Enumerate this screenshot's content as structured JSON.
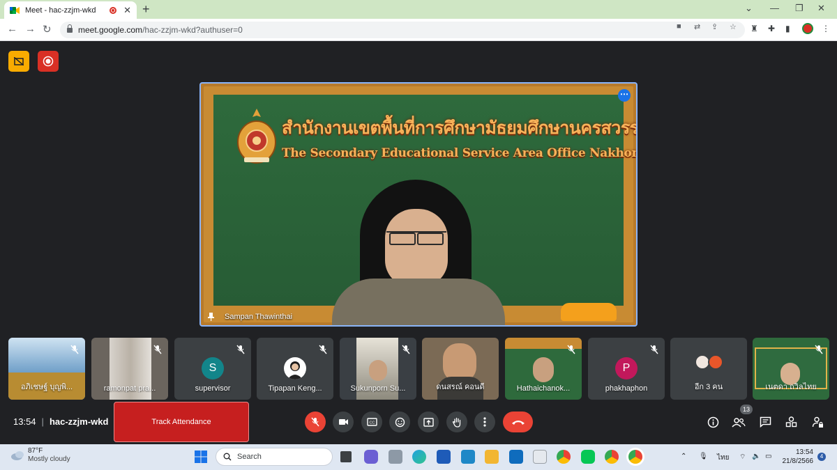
{
  "browser": {
    "tab_title": "Meet - hac-zzjm-wkd",
    "url_host": "meet.google.com",
    "url_path": "/hac-zzjm-wkd?authuser=0"
  },
  "stage": {
    "board_title_thai": "สำนักงานเขตพื้นที่การศึกษามัธยมศึกษานครสวรรค์",
    "board_title_eng": "The Secondary Educational Service Area Office Nakhon Sawan",
    "speaker_name": "Sampan Thawinthai"
  },
  "participants": [
    {
      "name": "อภิเชษฐ์ บุญพิ...",
      "type": "video",
      "muted": true
    },
    {
      "name": "ramonpat pra...",
      "type": "video",
      "muted": true
    },
    {
      "name": "supervisor",
      "type": "letter",
      "letter": "S",
      "color": "#12858a",
      "muted": true
    },
    {
      "name": "Tipapan Keng...",
      "type": "photo",
      "muted": true
    },
    {
      "name": "Sukunporn Su...",
      "type": "video",
      "muted": true
    },
    {
      "name": "ดนสรณ์ คอนดี",
      "type": "video",
      "muted": false
    },
    {
      "name": "Hathaichanok...",
      "type": "video",
      "muted": true
    },
    {
      "name": "phakhaphon",
      "type": "letter",
      "letter": "P",
      "color": "#c2185b",
      "muted": true
    },
    {
      "name": "อีก 3 คน",
      "type": "more",
      "muted": false
    },
    {
      "name": "เนตดา ถวิลไทย",
      "type": "video",
      "muted": true
    }
  ],
  "bottom_bar": {
    "time": "13:54",
    "meeting_code": "hac-zzjm-wkd",
    "track_attendance_label": "Track Attendance",
    "people_count": "13"
  },
  "taskbar": {
    "temperature": "87°F",
    "weather": "Mostly cloudy",
    "search_placeholder": "Search",
    "language": "ไทย",
    "time": "13:54",
    "date": "21/8/2566",
    "notifications": "4"
  },
  "colors": {
    "meet_bg": "#202124",
    "accent_blue": "#8ab4f8",
    "hangup_red": "#ea4335",
    "track_red": "#c61f1f",
    "tab_strip": "#cfe6c4"
  }
}
